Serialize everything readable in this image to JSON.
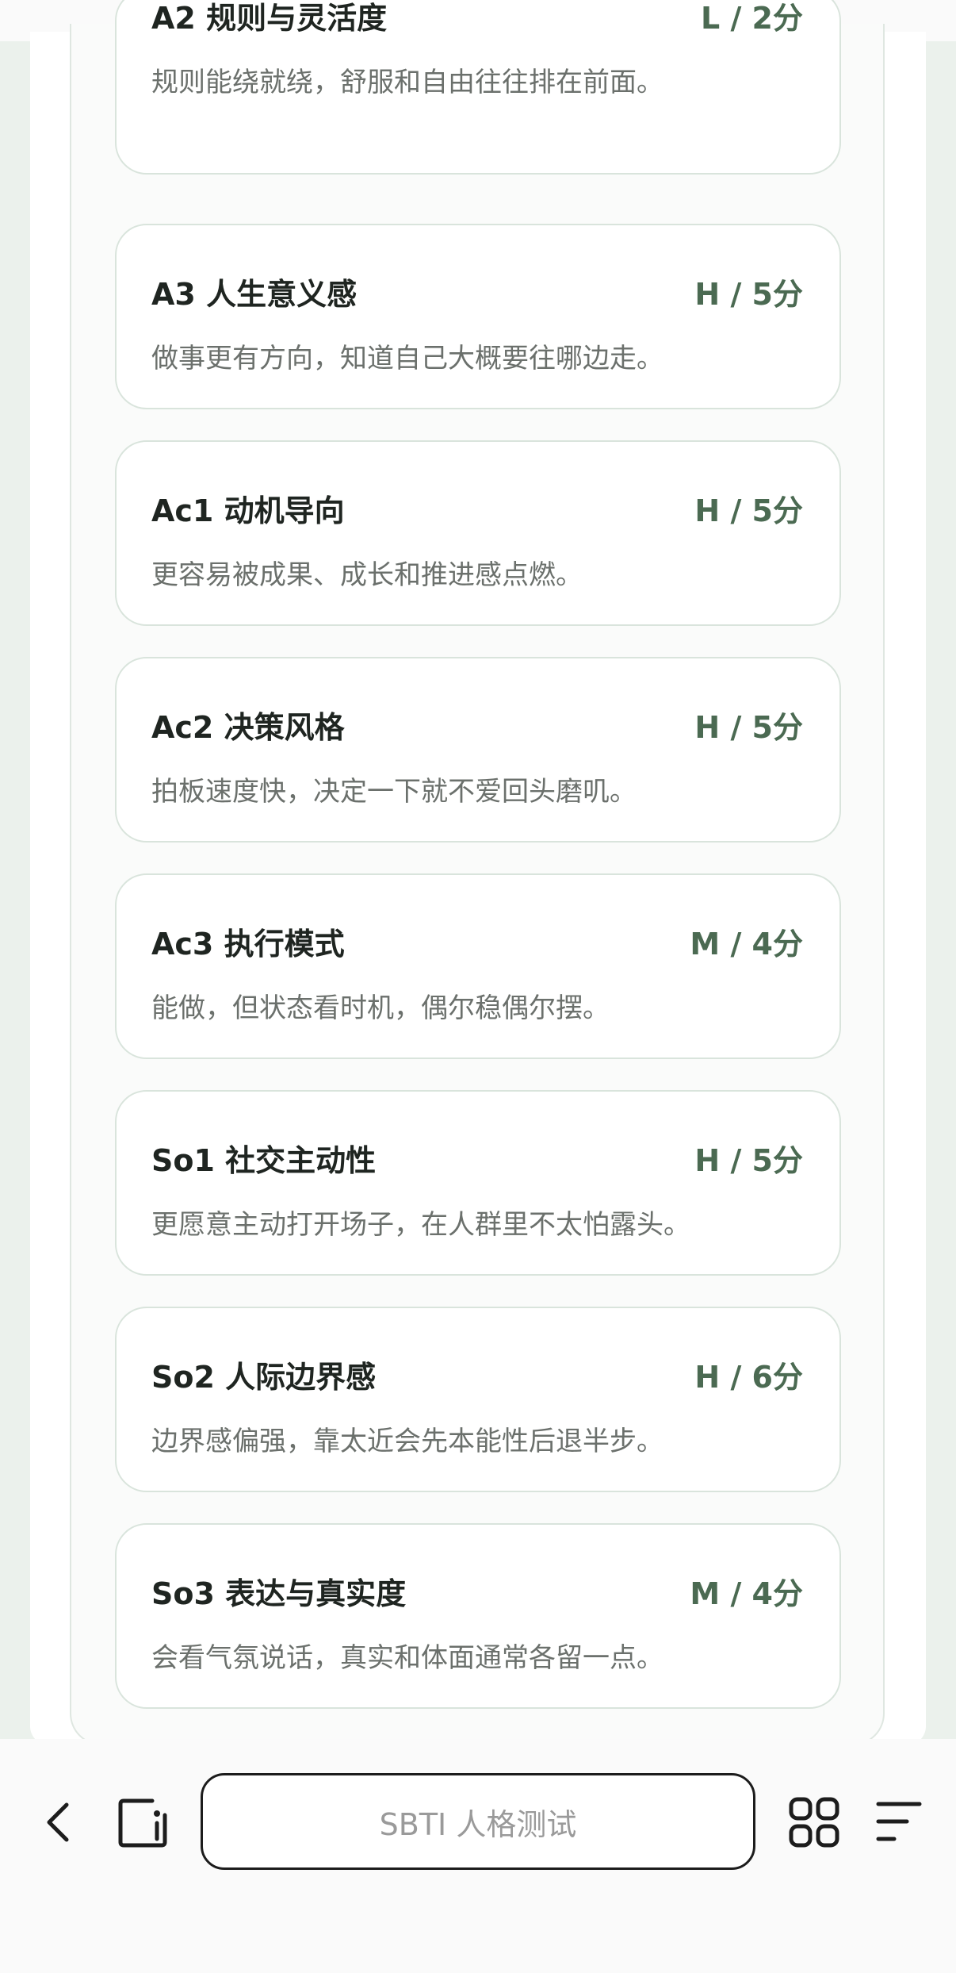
{
  "items": [
    {
      "title": "A2 规则与灵活度",
      "score": "L / 2分",
      "desc": "规则能绕就绕，舒服和自由往往排在前面。"
    },
    {
      "title": "A3 人生意义感",
      "score": "H / 5分",
      "desc": "做事更有方向，知道自己大概要往哪边走。"
    },
    {
      "title": "Ac1 动机导向",
      "score": "H / 5分",
      "desc": "更容易被成果、成长和推进感点燃。"
    },
    {
      "title": "Ac2 决策风格",
      "score": "H / 5分",
      "desc": "拍板速度快，决定一下就不爱回头磨叽。"
    },
    {
      "title": "Ac3 执行模式",
      "score": "M / 4分",
      "desc": "能做，但状态看时机，偶尔稳偶尔摆。"
    },
    {
      "title": "So1 社交主动性",
      "score": "H / 5分",
      "desc": "更愿意主动打开场子，在人群里不太怕露头。"
    },
    {
      "title": "So2 人际边界感",
      "score": "H / 6分",
      "desc": "边界感偏强，靠太近会先本能性后退半步。"
    },
    {
      "title": "So3 表达与真实度",
      "score": "M / 4分",
      "desc": "会看气氛说话，真实和体面通常各留一点。"
    }
  ],
  "toolbar": {
    "address_text": "SBTI 人格测试",
    "icons": {
      "back": "chevron-left-icon",
      "tab": "tab-icon",
      "apps": "grid-icon",
      "menu": "menu-icon"
    }
  },
  "colors": {
    "accent": "#4b6a52",
    "title": "#1f2521",
    "desc": "#6b706c",
    "card_border": "#d9e4dc",
    "background": "#ebf1ec"
  }
}
